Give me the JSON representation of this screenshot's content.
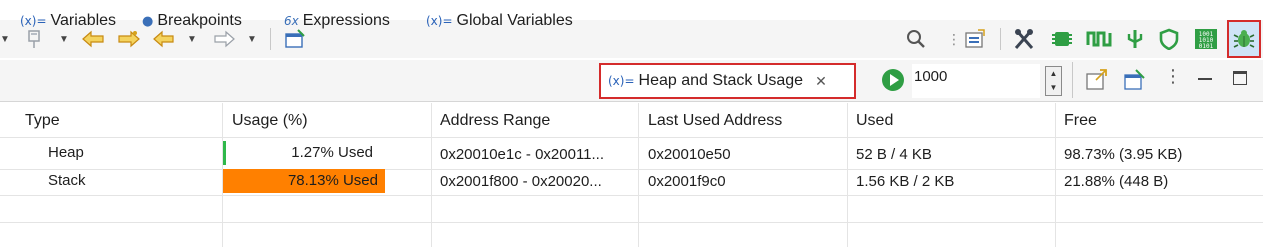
{
  "toolbar": {
    "icons_left": [
      "pin-icon",
      "back-arrow-icon",
      "forward-arrow-icon",
      "previous-icon",
      "next-icon",
      "new-window-icon"
    ],
    "icons_right": [
      "search-icon",
      "view-menu-icon",
      "tools-icon",
      "chip-icon",
      "signal-icon",
      "probe-icon",
      "shield-icon",
      "binary-icon",
      "bug-icon"
    ]
  },
  "tabs": [
    {
      "icon_text": "(x)=",
      "label": "Variables"
    },
    {
      "icon_text": "●",
      "label": "Breakpoints"
    },
    {
      "icon_text": "6x",
      "label": "Expressions"
    },
    {
      "icon_text": "(x)=",
      "label": "Global Variables"
    }
  ],
  "active_tab": {
    "icon_text": "(x)=",
    "label": "Heap and Stack Usage",
    "close": "✕"
  },
  "refresh": {
    "interval": "1000"
  },
  "table": {
    "headers": [
      "Type",
      "Usage (%)",
      "Address Range",
      "Last Used Address",
      "Used",
      "Free"
    ],
    "rows": [
      {
        "type": "Heap",
        "usage": "1.27% Used",
        "usage_fraction": 0.0127,
        "address_range": "0x20010e1c - 0x20011...",
        "last_used": "0x20010e50",
        "used": "52 B / 4 KB",
        "free": "98.73% (3.95 KB)"
      },
      {
        "type": "Stack",
        "usage": "78.13% Used",
        "usage_fraction": 0.7813,
        "address_range": "0x2001f800 - 0x20020...",
        "last_used": "0x2001f9c0",
        "used": "1.56 KB / 2 KB",
        "free": "21.88% (448 B)"
      }
    ]
  },
  "colors": {
    "heap_bar": "#2fb84a",
    "stack_bar": "#ff8000",
    "highlight": "#d42b2b"
  }
}
